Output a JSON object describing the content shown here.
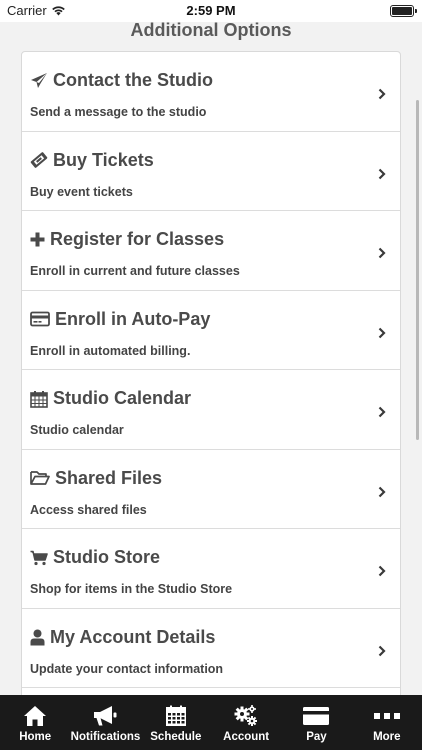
{
  "status_bar": {
    "carrier": "Carrier",
    "time": "2:59 PM"
  },
  "page": {
    "title": "Additional Options"
  },
  "options": [
    {
      "title": "Contact the Studio",
      "subtitle": "Send a message to the studio",
      "icon": "paper-plane-icon"
    },
    {
      "title": "Buy Tickets",
      "subtitle": "Buy event tickets",
      "icon": "ticket-icon"
    },
    {
      "title": "Register for Classes",
      "subtitle": "Enroll in current and future classes",
      "icon": "plus-icon"
    },
    {
      "title": "Enroll in Auto-Pay",
      "subtitle": "Enroll in automated billing.",
      "icon": "credit-card-icon"
    },
    {
      "title": "Studio Calendar",
      "subtitle": "Studio calendar",
      "icon": "calendar-icon"
    },
    {
      "title": "Shared Files",
      "subtitle": "Access shared files",
      "icon": "folder-open-icon"
    },
    {
      "title": "Studio Store",
      "subtitle": "Shop for items in the Studio Store",
      "icon": "shopping-cart-icon"
    },
    {
      "title": "My Account Details",
      "subtitle": "Update your contact information",
      "icon": "user-icon"
    }
  ],
  "tabs": [
    {
      "label": "Home",
      "icon": "home-icon"
    },
    {
      "label": "Notifications",
      "icon": "megaphone-icon"
    },
    {
      "label": "Schedule",
      "icon": "calendar-grid-icon"
    },
    {
      "label": "Account",
      "icon": "gears-icon"
    },
    {
      "label": "Pay",
      "icon": "credit-card-icon"
    },
    {
      "label": "More",
      "icon": "ellipsis-icon"
    }
  ]
}
